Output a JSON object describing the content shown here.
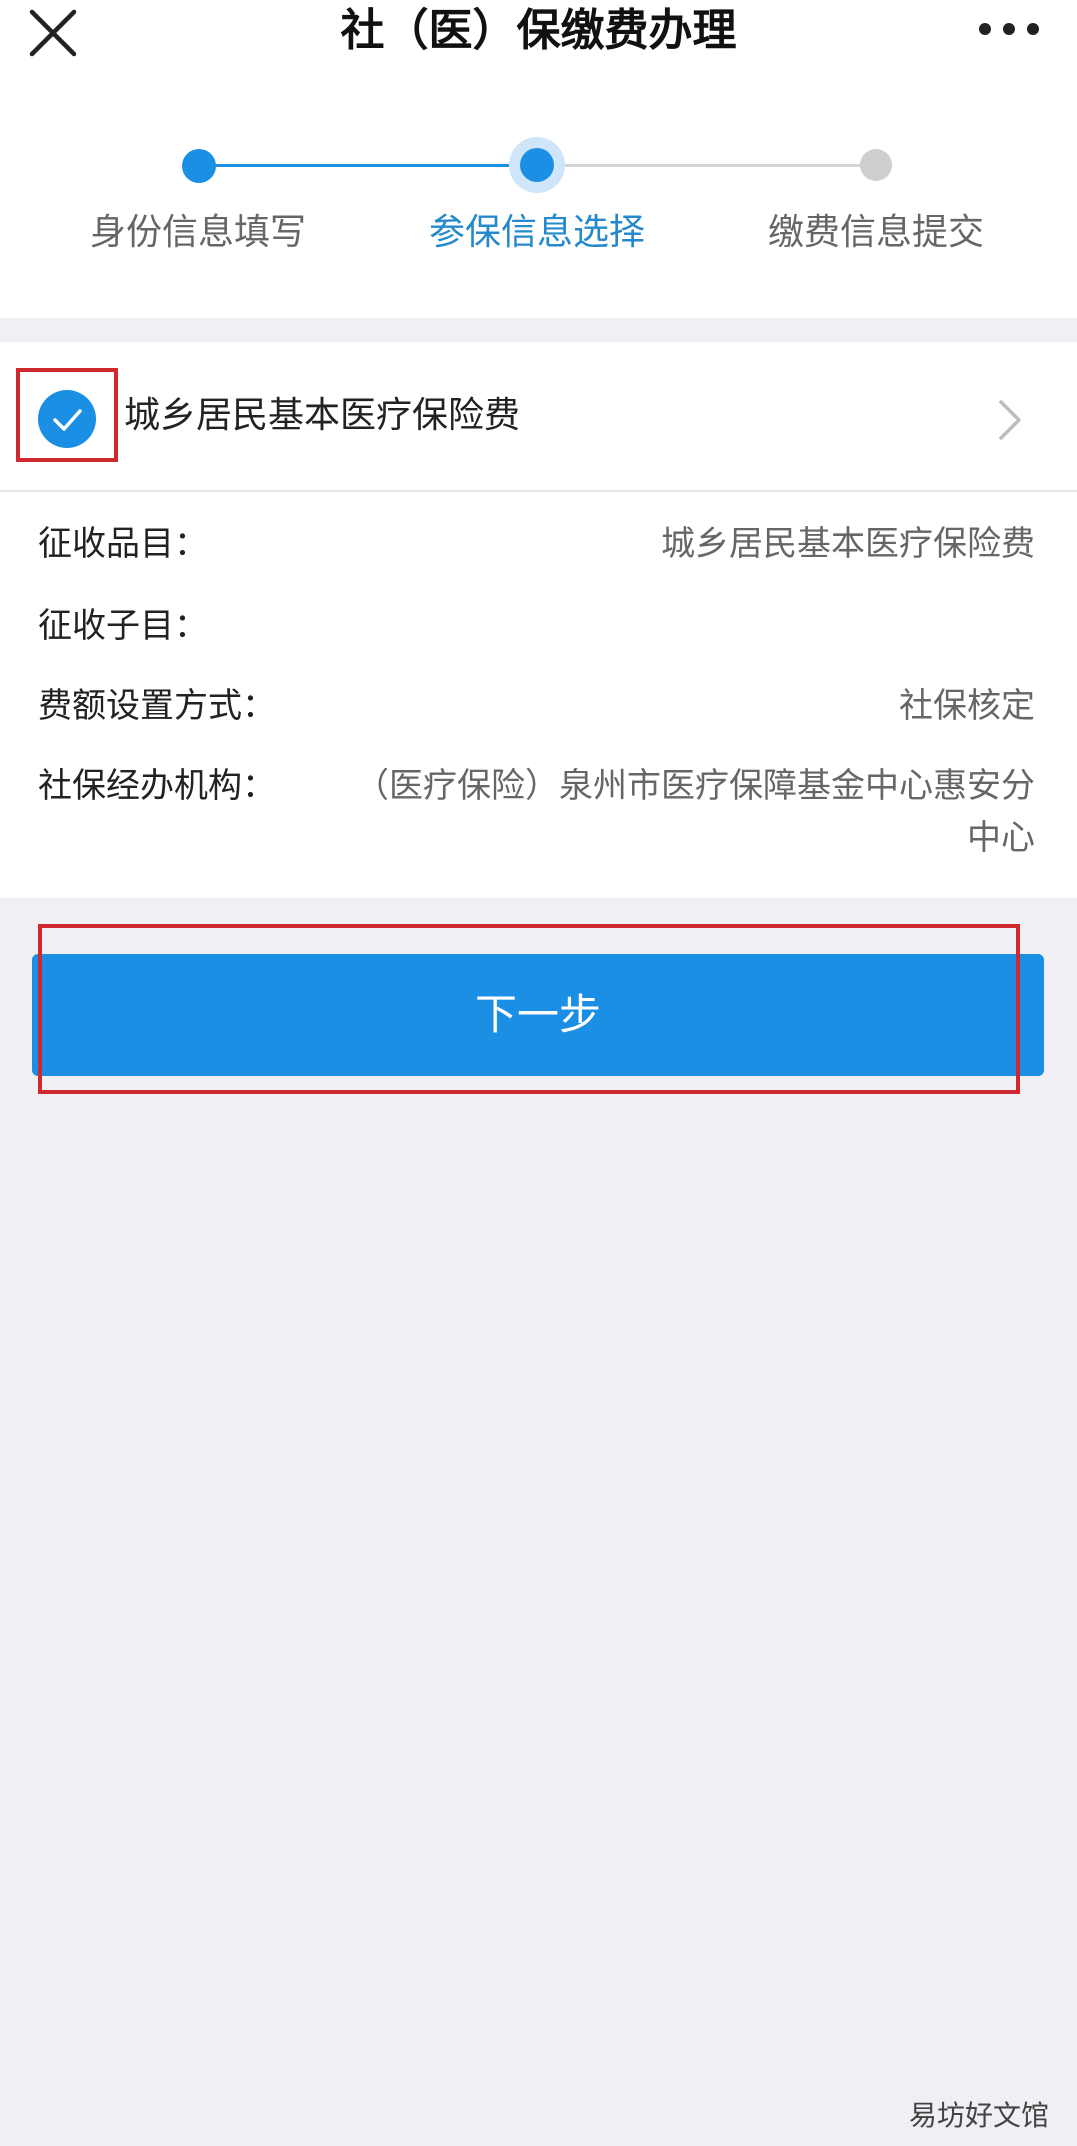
{
  "header": {
    "title": "社（医）保缴费办理",
    "close_icon": "close-icon",
    "more_icon": "more-icon"
  },
  "stepper": {
    "steps": [
      {
        "label": "身份信息填写",
        "state": "done"
      },
      {
        "label": "参保信息选择",
        "state": "current"
      },
      {
        "label": "缴费信息提交",
        "state": "pending"
      }
    ],
    "colors": {
      "active": "#1a8fe3",
      "inactive": "#cfcfcf",
      "current_label": "#2589cc"
    }
  },
  "insurance_item": {
    "name": "城乡居民基本医疗保险费",
    "checked": true,
    "details": [
      {
        "key": "征收品目：",
        "value": "城乡居民基本医疗保险费"
      },
      {
        "key": "征收子目：",
        "value": ""
      },
      {
        "key": "费额设置方式：",
        "value": "社保核定"
      },
      {
        "key": "社保经办机构：",
        "value": "（医疗保险）泉州市医疗保障基金中心惠安分中心"
      }
    ]
  },
  "next_button": {
    "label": "下一步"
  },
  "highlight_color": "#d0282f",
  "watermark": "易坊好文馆"
}
